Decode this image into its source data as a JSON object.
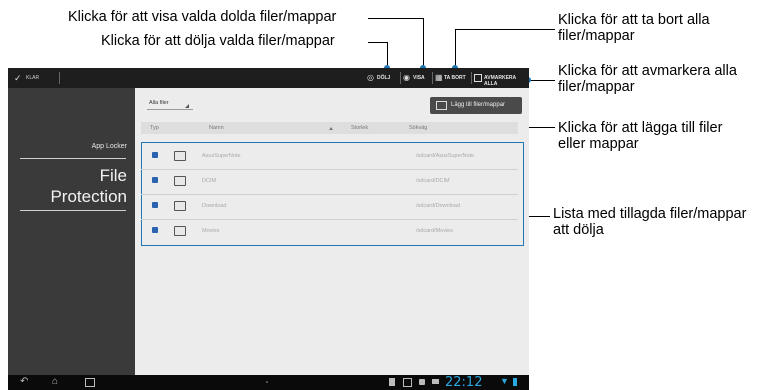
{
  "callouts": {
    "show_hidden": "Klicka för att visa valda dolda filer/mappar",
    "hide_selected": "Klicka för att dölja valda filer/mappar",
    "delete_all_1": "Klicka för att ta bort alla",
    "delete_all_2": "filer/mappar",
    "deselect_all_1": "Klicka för att avmarkera alla",
    "deselect_all_2": "filer/mappar",
    "add_1": "Klicka för att lägga till filer",
    "add_2": "eller mappar",
    "list_1": "Lista med tillagda filer/mappar",
    "list_2": "att dölja"
  },
  "actionbar": {
    "done_label": "KLAR",
    "hide_label": "DÖLJ",
    "show_label": "VISA",
    "delete_label": "TA BORT",
    "deselect_label": "AVMARKERA ALLA"
  },
  "sidebar": {
    "app_locker": "App Locker",
    "file": "File",
    "protection": "Protection"
  },
  "main": {
    "filter_value": "Alla filer",
    "add_button": "Lägg till filer/mappar",
    "columns": {
      "type": "Typ",
      "name": "Namn",
      "size": "Storlek",
      "path": "Sökväg"
    },
    "rows": [
      {
        "name": "AsusSuperNote",
        "path": "/sdcard/AsusSuperNote"
      },
      {
        "name": "DCIM",
        "path": "/sdcard/DCIM"
      },
      {
        "name": "Download",
        "path": "/sdcard/Download"
      },
      {
        "name": "Movies",
        "path": "/sdcard/Movies"
      }
    ]
  },
  "statusbar": {
    "time": "22:12"
  },
  "colors": {
    "accent": "#1f78b4",
    "actionbar": "#1e1e1e",
    "sidebar": "#3a3a3a",
    "clock": "#2aa8e0"
  }
}
